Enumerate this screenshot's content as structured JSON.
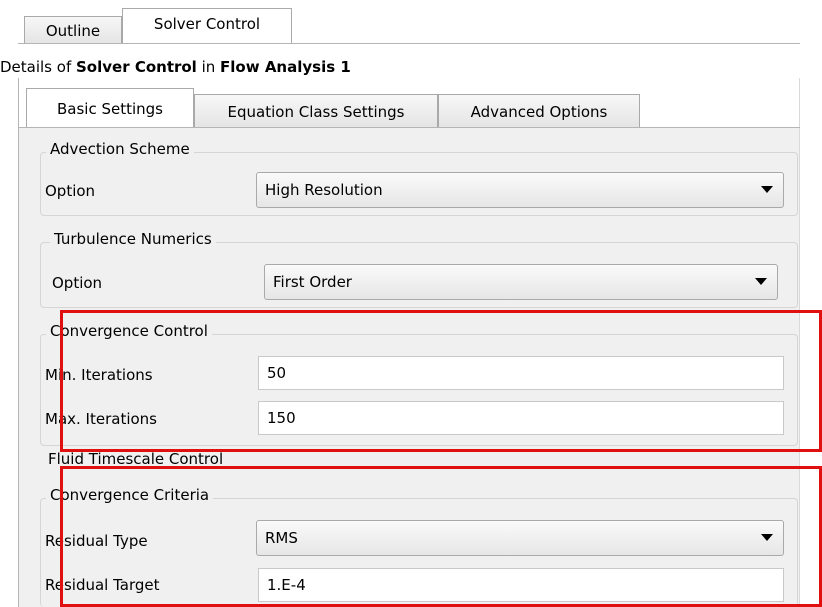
{
  "outer_tabs": [
    {
      "label": "Outline"
    },
    {
      "label": "Solver Control"
    }
  ],
  "details": {
    "prefix": "Details of ",
    "object": "Solver Control",
    "middle": " in ",
    "parent": "Flow Analysis 1"
  },
  "inner_tabs": [
    {
      "label": "Basic Settings"
    },
    {
      "label": "Equation Class Settings"
    },
    {
      "label": "Advanced Options"
    }
  ],
  "advection": {
    "title": "Advection Scheme",
    "option_label": "Option",
    "option_value": "High Resolution"
  },
  "turbulence": {
    "title": "Turbulence Numerics",
    "option_label": "Option",
    "option_value": "First Order"
  },
  "convergence_control": {
    "title": "Convergence Control",
    "min_label": "Min. Iterations",
    "min_value": "50",
    "max_label": "Max. Iterations",
    "max_value": "150"
  },
  "fluid_timescale": {
    "title": "Fluid Timescale Control"
  },
  "convergence_criteria": {
    "title": "Convergence Criteria",
    "residual_type_label": "Residual Type",
    "residual_type_value": "RMS",
    "residual_target_label": "Residual Target",
    "residual_target_value": "1.E-4"
  },
  "colors": {
    "highlight": "#e01010",
    "panel_bg": "#f0f0f0"
  }
}
